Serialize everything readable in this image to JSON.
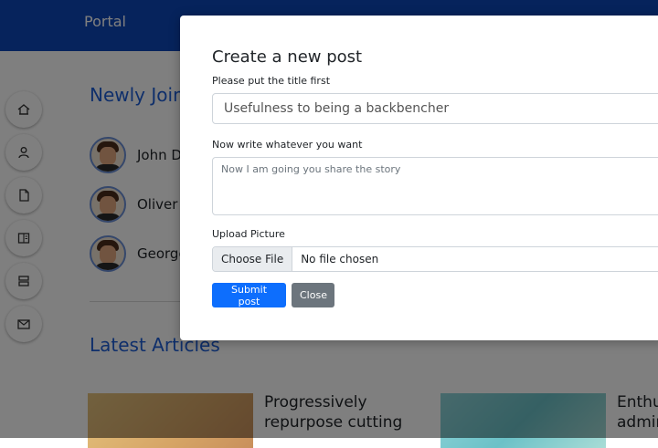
{
  "header": {
    "brand": "Portal"
  },
  "sidebar": {
    "icons": [
      "home-icon",
      "user-icon",
      "document-icon",
      "book-icon",
      "server-icon",
      "mail-icon"
    ]
  },
  "members": {
    "title": "Newly Joined Members",
    "items": [
      {
        "name": "John Doe"
      },
      {
        "name": "Oliver Jones"
      },
      {
        "name": "George Smith"
      }
    ]
  },
  "articles": {
    "title": "Latest Articles",
    "items": [
      {
        "title_line1": "Progressively",
        "title_line2": "repurpose cutting"
      },
      {
        "title_line1": "Enthusiastically",
        "title_line2": "administrate"
      }
    ]
  },
  "modal": {
    "title": "Create a new post",
    "title_label": "Please put the title first",
    "title_value": "Usefulness to being a backbencher",
    "body_label": "Now write whatever you want",
    "body_placeholder": "Now I am going you share the story",
    "upload_label": "Upload Picture",
    "choose_file": "Choose File",
    "file_status": "No file chosen",
    "submit_label": "Submit post",
    "close_label": "Close"
  },
  "colors": {
    "header": "#0d47b8",
    "accent": "#1f5fd6",
    "primary_button": "#0d6efd",
    "secondary_button": "#6c757d"
  }
}
